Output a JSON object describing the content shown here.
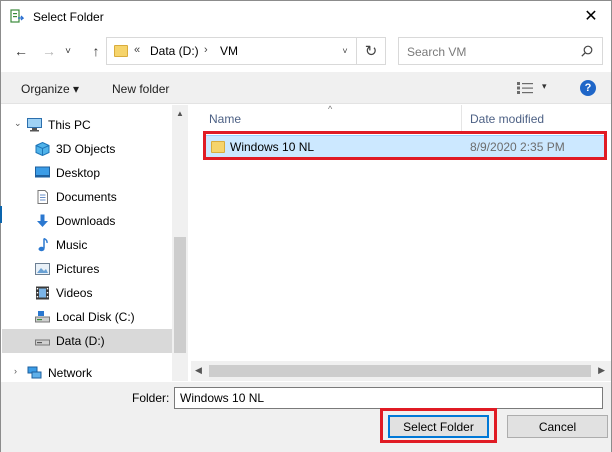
{
  "window": {
    "title": "Select Folder",
    "close_glyph": "✕",
    "icon": "folder-picker-icon"
  },
  "navigation": {
    "back_glyph": "←",
    "forward_glyph": "→",
    "recent_glyph": "˅",
    "up_glyph": "↑",
    "refresh_glyph": "↻"
  },
  "address": {
    "overflow": "«",
    "segments": [
      "Data (D:)",
      "VM"
    ],
    "separator": "›",
    "dropdown_glyph": "˅"
  },
  "search": {
    "placeholder": "Search VM",
    "icon": "search-icon"
  },
  "toolbar": {
    "organize_label": "Organize ▾",
    "new_folder_label": "New folder",
    "view_dropdown_glyph": "▾",
    "help_glyph": "?"
  },
  "sidebar": {
    "items": [
      {
        "label": "This PC",
        "icon": "this-pc-icon"
      },
      {
        "label": "3D Objects",
        "icon": "3d-objects-icon"
      },
      {
        "label": "Desktop",
        "icon": "desktop-icon"
      },
      {
        "label": "Documents",
        "icon": "documents-icon"
      },
      {
        "label": "Downloads",
        "icon": "downloads-icon"
      },
      {
        "label": "Music",
        "icon": "music-icon"
      },
      {
        "label": "Pictures",
        "icon": "pictures-icon"
      },
      {
        "label": "Videos",
        "icon": "videos-icon"
      },
      {
        "label": "Local Disk (C:)",
        "icon": "local-disk-icon"
      },
      {
        "label": "Data (D:)",
        "icon": "data-drive-icon",
        "selected": true
      },
      {
        "label": "Network",
        "icon": "network-icon"
      }
    ]
  },
  "file_list": {
    "columns": [
      "Name",
      "Date modified"
    ],
    "sort_glyph": "^",
    "rows": [
      {
        "name": "Windows 10 NL",
        "date_modified": "8/9/2020 2:35 PM",
        "selected": true
      }
    ]
  },
  "footer": {
    "folder_label": "Folder:",
    "folder_value": "Windows 10 NL",
    "select_button": "Select Folder",
    "cancel_button": "Cancel"
  },
  "colors": {
    "accent": "#0078d7",
    "highlight_annotation": "#e01b24",
    "selection": "#cce8ff"
  }
}
